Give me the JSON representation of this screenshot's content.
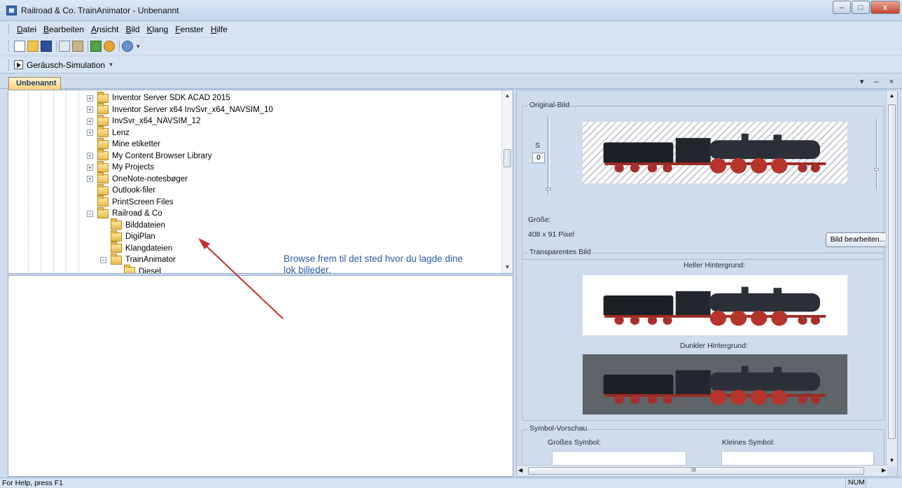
{
  "window": {
    "title": "Railroad & Co. TrainAnimator - Unbenannt",
    "controls": [
      "–",
      "□",
      "x"
    ]
  },
  "menu": [
    {
      "key": "D",
      "rest": "atei"
    },
    {
      "key": "B",
      "rest": "earbeiten"
    },
    {
      "key": "A",
      "rest": "nsicht"
    },
    {
      "key": "B",
      "rest": "ild"
    },
    {
      "key": "K",
      "rest": "lang"
    },
    {
      "key": "F",
      "rest": "enster"
    },
    {
      "key": "H",
      "rest": "ilfe"
    }
  ],
  "toolbar": {
    "icons": [
      "new-icon",
      "open-icon",
      "save-icon",
      "copy-icon",
      "paste-icon",
      "picture-icon",
      "sound-icon",
      "about-icon"
    ],
    "chevron": "▾"
  },
  "simbar": {
    "label": "Geräusch-Simulation",
    "chevron": "▾"
  },
  "doc": {
    "tab": "Unbenannt",
    "controls": "▾ – ×"
  },
  "tree": {
    "items": [
      {
        "label": "Inventor Server SDK ACAD 2015",
        "expandable": true
      },
      {
        "label": "Inventor Server x64 InvSvr_x64_NAVSIM_10",
        "expandable": true
      },
      {
        "label": "InvSvr_x64_NAVSIM_12",
        "expandable": true
      },
      {
        "label": "Lenz",
        "expandable": true
      },
      {
        "label": "Mine etiketter",
        "expandable": false
      },
      {
        "label": "My Content Browser Library",
        "expandable": true
      },
      {
        "label": "My Projects",
        "expandable": true
      },
      {
        "label": "OneNote-notesbøger",
        "expandable": true
      },
      {
        "label": "Outlook-filer",
        "expandable": false
      },
      {
        "label": "PrintScreen Files",
        "expandable": false
      },
      {
        "label": "Railroad & Co",
        "expandable": true,
        "expanded": true
      },
      {
        "label": "Bilddateien",
        "expandable": false,
        "child": true
      },
      {
        "label": "DigiPlan",
        "expandable": false,
        "child": true
      },
      {
        "label": "Klangdateien",
        "expandable": false,
        "child": true
      },
      {
        "label": "TrainAnimator",
        "expandable": true,
        "expanded": true,
        "child": true
      },
      {
        "label": "Diesel",
        "expandable": false,
        "grandchild": true
      }
    ]
  },
  "annotation": {
    "text": "Browse frem til det sted hvor du lagde dine lok billeder."
  },
  "original": {
    "group_label": "Original-Bild",
    "s_label": "S",
    "s_value": "0",
    "size_label": "Größe:",
    "size_value": "408 x 91 Pixel",
    "edit_button": "Bild bearbeiten..."
  },
  "transparent": {
    "group_label": "Transparentes Bild",
    "light_label": "Heller Hintergrund:",
    "dark_label": "Dunkler Hintergrund:"
  },
  "symbols": {
    "group_label": "Symbol-Vorschau",
    "large_label": "Großes Symbol:",
    "small_label": "Kleines Symbol:"
  },
  "scroll": {
    "hgrip": "III"
  },
  "status": {
    "text": "For Help, press F1",
    "num": "NUM"
  }
}
